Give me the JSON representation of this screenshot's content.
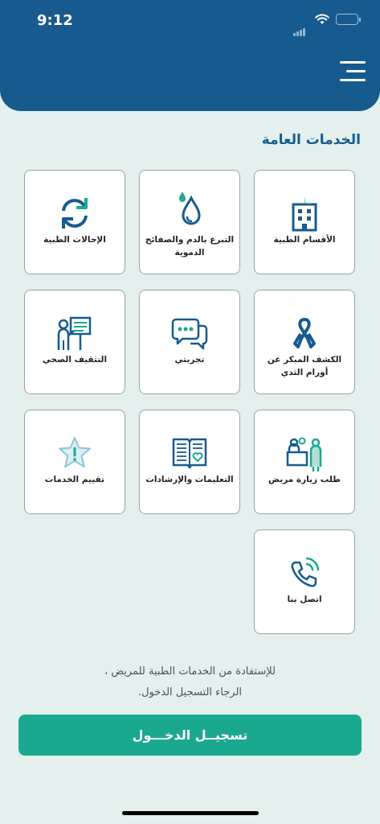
{
  "status_bar": {
    "time": "9:12"
  },
  "section": {
    "title": "الخدمات العامة"
  },
  "tiles": [
    {
      "label": "الأقسام الطبية",
      "icon": "hospital-icon"
    },
    {
      "label": "التبرع بالدم والصفائح الدموية",
      "icon": "blood-drop-icon"
    },
    {
      "label": "الإحالات الطبية",
      "icon": "refresh-icon"
    },
    {
      "label": "الكشف المبكر عن أورام الثدي",
      "icon": "awareness-ribbon-icon"
    },
    {
      "label": "تجربتي",
      "icon": "chat-bubbles-icon"
    },
    {
      "label": "التثقيف الصحي",
      "icon": "presentation-board-icon"
    },
    {
      "label": "طلب زيارة مريض",
      "icon": "patient-visit-icon"
    },
    {
      "label": "التعليمات والإرشادات",
      "icon": "open-book-icon"
    },
    {
      "label": "تقييم الخدمات",
      "icon": "star-rating-icon"
    },
    {
      "label": "اتصل بنا",
      "icon": "phone-call-icon"
    }
  ],
  "notice": {
    "line1": "للإستفادة من الخدمات الطبية للمريض ،",
    "line2": "الرجاء التسجيل الدخول."
  },
  "login_button": {
    "label": "تسجيــل الدخـــول"
  },
  "colors": {
    "header": "#175b8e",
    "accent": "#1aa98e",
    "background": "#e3f0ee"
  }
}
